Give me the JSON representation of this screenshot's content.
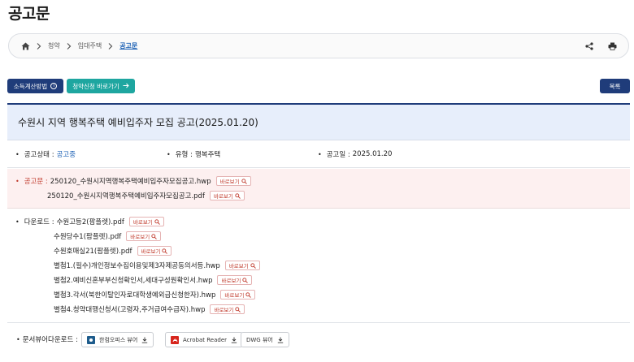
{
  "page": {
    "title": "공고문"
  },
  "breadcrumb": {
    "items": [
      "청약",
      "임대주택"
    ],
    "current": "공고문"
  },
  "buttons": {
    "income_label": "소득계산방법",
    "apply_label": "청약신청 바로가기",
    "list_label": "목록"
  },
  "notice": {
    "title": "수원시 지역 행복주택 예비입주자 모집 공고(2025.01.20)",
    "status_label": "공고상태 :",
    "status_value": "공고중",
    "type_label": "유형 :",
    "type_value": "행복주택",
    "date_label": "공고일 :",
    "date_value": "2025.01.20"
  },
  "notice_files": {
    "label": "공고문 :",
    "files": [
      "250120_수원시지역행복주택예비입주자모집공고.hwp",
      "250120_수원시지역행복주택예비입주자모집공고.pdf"
    ]
  },
  "downloads": {
    "label": "다운로드 :",
    "files": [
      "수원고등2(팜플렛).pdf",
      "수원당수1(팜플렛).pdf",
      "수원호매실21(팜플렛).pdf",
      "별첨1.(필수)개인정보수집이용및제3자제공동의서등.hwp",
      "별첨2.예비신혼부부신청확인서,세대구성원확인서.hwp",
      "별첨3.각서(북한이탈인자로대학생예외급신청한자).hwp",
      "별첨4.청약대행신청서(고령자,주거급여수급자).hwp"
    ]
  },
  "view_button_label": "바로보기",
  "viewers": {
    "label": "문서뷰어다운로드 :",
    "items": [
      {
        "name": "한컴오피스 뷰어",
        "icon": "hancom-icon",
        "color": "#1e5c8c"
      },
      {
        "name": "Acrobat Reader",
        "icon": "acrobat-icon",
        "color": "#d7261e"
      },
      {
        "name": "DWG 뷰어",
        "icon": "",
        "color": ""
      }
    ]
  },
  "colors": {
    "navy": "#1f3c7a",
    "teal": "#1ea6a0",
    "link_blue": "#1a5fb4",
    "red": "#c0392b",
    "title_bg": "#e7eefb",
    "notice_bg": "#fdf0f0"
  }
}
